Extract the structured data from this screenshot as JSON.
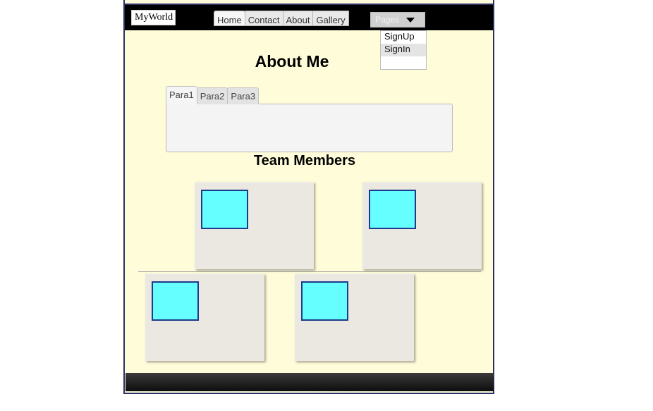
{
  "brand": {
    "label": "MyWorld"
  },
  "nav": {
    "tabs": [
      {
        "label": "Home"
      },
      {
        "label": "Contact"
      },
      {
        "label": "About"
      },
      {
        "label": "Gallery"
      }
    ]
  },
  "pages_menu": {
    "label": "Pages",
    "items": [
      {
        "label": "SignUp"
      },
      {
        "label": "SignIn"
      }
    ]
  },
  "about": {
    "title": "About Me",
    "tabs": [
      {
        "label": "Para1"
      },
      {
        "label": "Para2"
      },
      {
        "label": "Para3"
      }
    ]
  },
  "team": {
    "title": "Team Members"
  },
  "colors": {
    "page_background": "#fffcd9",
    "photo_fill": "#66ffff",
    "photo_border": "#1e3a8a",
    "card_background": "#ebe8e1",
    "frame_border": "#2b2f63"
  }
}
